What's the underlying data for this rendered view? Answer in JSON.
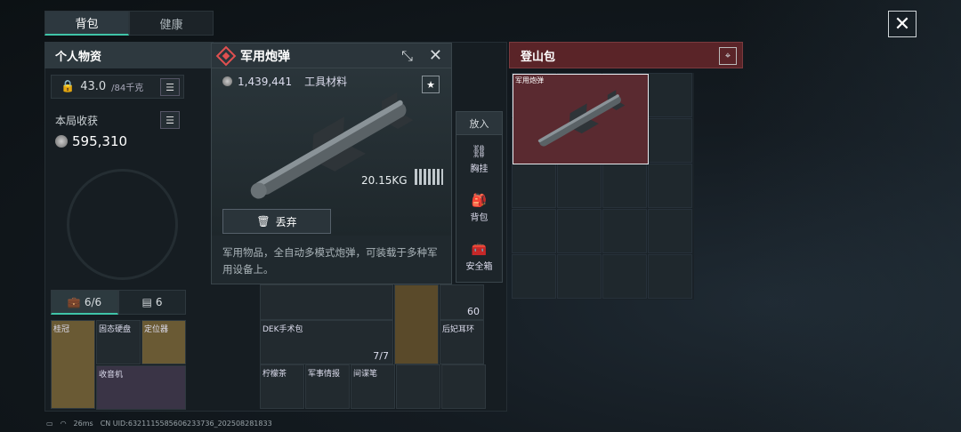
{
  "tabs": [
    "背包",
    "健康"
  ],
  "left_panel": {
    "title": "个人物资",
    "weight": "43.0",
    "weight_unit": "/84千克",
    "earnings_label": "本局收获",
    "earnings_value": "595,310"
  },
  "container_tabs": {
    "case": "6/6",
    "card": "6"
  },
  "item_popup": {
    "title": "军用炮弹",
    "price": "1,439,441",
    "category": "工具材料",
    "weight": "20.15KG",
    "discard": "丢弃",
    "description": "军用物品，全自动多模式炮弹，可装载于多种军用设备上。"
  },
  "side_menu": {
    "header": "放入",
    "items": [
      "胸挂",
      "背包",
      "安全箱"
    ]
  },
  "right_panel": {
    "title": "登山包",
    "item_label": "军用炮弹"
  },
  "slots": {
    "laurel": "桂冠",
    "ssd": "固态硬盘",
    "locator": "定位器",
    "radio": "收音机",
    "dek": "DEK手术包",
    "dek_count": "7/7",
    "queen_earring": "后妃耳环",
    "lemon": "柠檬茶",
    "intel": "军事情报",
    "spy_pen": "间谍笔",
    "ammo_count": "60"
  },
  "status": {
    "ping": "26ms",
    "uid": "CN UID:6321115585606233736_202508281833"
  }
}
